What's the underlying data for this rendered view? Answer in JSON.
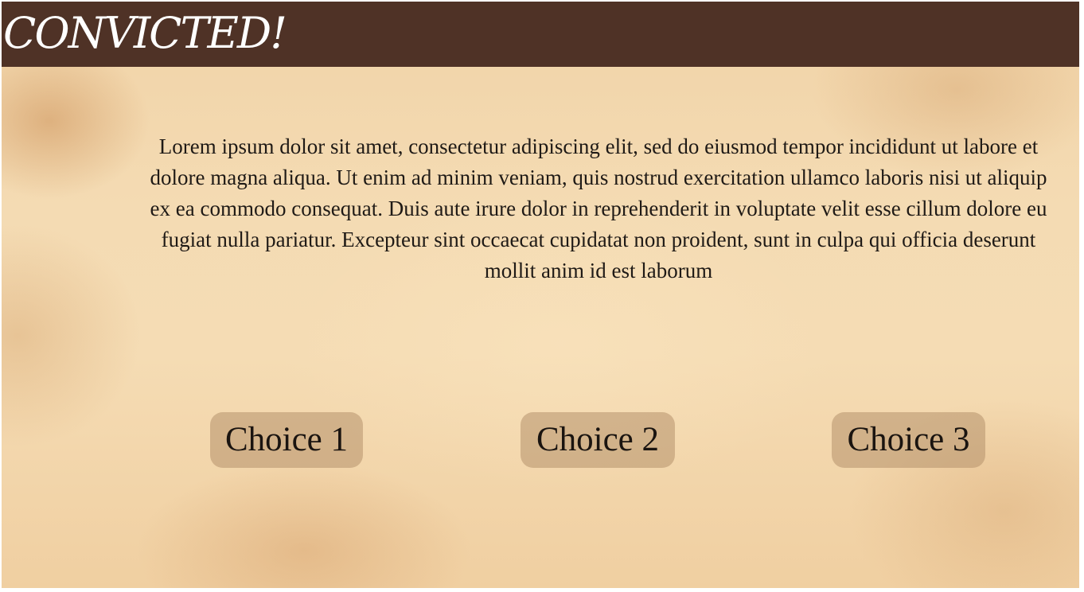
{
  "header": {
    "title": "CONVICTED!"
  },
  "story": {
    "text": "Lorem ipsum dolor sit amet, consectetur adipiscing elit, sed do eiusmod tempor incididunt ut labore et dolore magna aliqua. Ut enim ad minim veniam, quis nostrud exercitation ullamco laboris nisi ut aliquip ex ea commodo consequat. Duis aute irure dolor in reprehenderit in voluptate velit esse cillum dolore eu fugiat nulla pariatur. Excepteur sint occaecat cupidatat non proident, sunt in culpa qui officia deserunt mollit anim id est laborum"
  },
  "choices": [
    {
      "label": "Choice 1"
    },
    {
      "label": "Choice 2"
    },
    {
      "label": "Choice 3"
    }
  ],
  "colors": {
    "header_background": "#4f3226",
    "parchment": "#f4dbb3",
    "choice_background": "#c9a87f",
    "text": "#1f1a16"
  }
}
